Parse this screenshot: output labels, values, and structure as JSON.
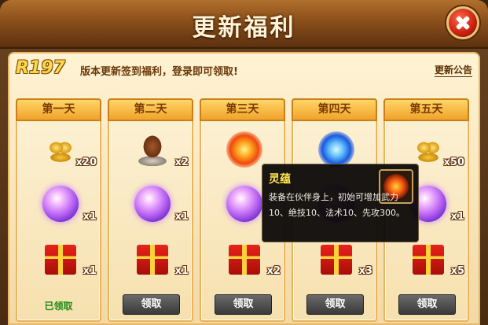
{
  "window": {
    "title": "更新福利"
  },
  "banner": {
    "code": "R197",
    "text": "版本更新签到福利，登录即可领取!",
    "announcement_link": "更新公告"
  },
  "days": [
    {
      "label": "第一天",
      "items": [
        {
          "icon": "gold-ingot-icon",
          "qty": "x20"
        },
        {
          "icon": "purple-orb-icon",
          "qty": "x1"
        },
        {
          "icon": "gift-box-icon",
          "qty": "x1"
        }
      ],
      "status": "已领取",
      "claimed": true
    },
    {
      "label": "第二天",
      "items": [
        {
          "icon": "egg-bowl-icon",
          "qty": "x2"
        },
        {
          "icon": "purple-orb-icon",
          "qty": "x1"
        },
        {
          "icon": "gift-box-icon",
          "qty": "x1"
        }
      ],
      "status": "领取",
      "claimed": false
    },
    {
      "label": "第三天",
      "items": [
        {
          "icon": "fire-swirl-icon",
          "qty": ""
        },
        {
          "icon": "purple-orb-icon",
          "qty": ""
        },
        {
          "icon": "gift-box-icon",
          "qty": "x2"
        }
      ],
      "status": "领取",
      "claimed": false
    },
    {
      "label": "第四天",
      "items": [
        {
          "icon": "blue-crystal-icon",
          "qty": ""
        },
        {
          "icon": "purple-orb-icon",
          "qty": ""
        },
        {
          "icon": "gift-box-icon",
          "qty": "x3"
        }
      ],
      "status": "领取",
      "claimed": false
    },
    {
      "label": "第五天",
      "items": [
        {
          "icon": "gold-ingot-icon",
          "qty": "x50"
        },
        {
          "icon": "purple-orb-icon",
          "qty": "x1"
        },
        {
          "icon": "gift-box-icon",
          "qty": "x5"
        }
      ],
      "status": "领取",
      "claimed": false
    }
  ],
  "tooltip": {
    "title": "灵蕴",
    "description": "装备在伙伴身上，初始可增加武力10、绝技10、法术10、先攻300。",
    "icon": "fire-swirl-icon"
  },
  "colors": {
    "title_text": "#fff4d6",
    "claimed_text": "#1e8a12",
    "tooltip_title": "#ffe44a",
    "banner_code": "#ffd84a"
  }
}
